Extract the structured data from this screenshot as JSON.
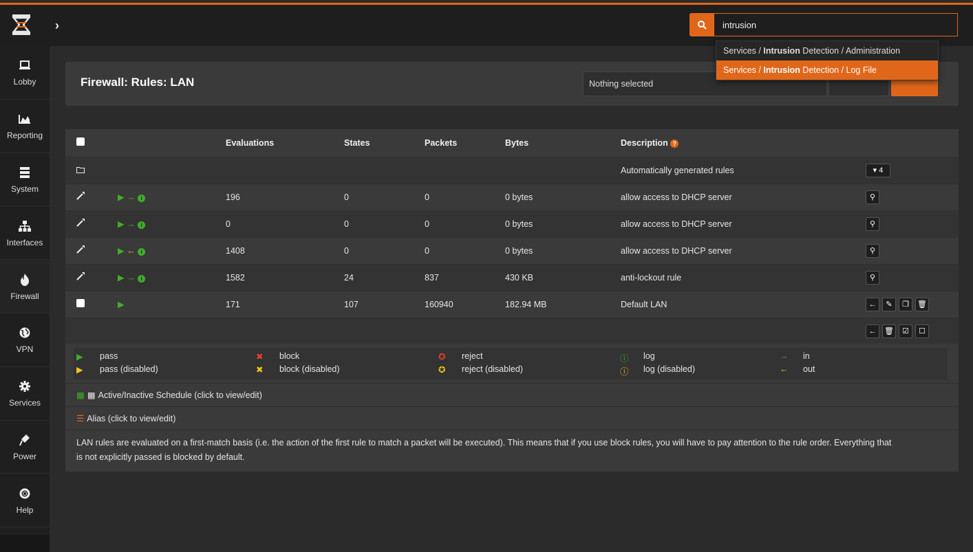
{
  "header": {
    "search_value": "intrusion",
    "dropdown": [
      {
        "pre": "Services / ",
        "bold": "Intrusion",
        "post": " Detection / Administration",
        "active": false
      },
      {
        "pre": "Services / ",
        "bold": "Intrusion",
        "post": " Detection / Log File",
        "active": true
      }
    ]
  },
  "nav": {
    "items": [
      {
        "label": "Lobby",
        "icon": "laptop-icon"
      },
      {
        "label": "Reporting",
        "icon": "area-chart-icon"
      },
      {
        "label": "System",
        "icon": "server-icon"
      },
      {
        "label": "Interfaces",
        "icon": "sitemap-icon"
      },
      {
        "label": "Firewall",
        "icon": "fire-icon"
      },
      {
        "label": "VPN",
        "icon": "globe-icon"
      },
      {
        "label": "Services",
        "icon": "cog-icon"
      },
      {
        "label": "Power",
        "icon": "plug-icon"
      },
      {
        "label": "Help",
        "icon": "life-ring-icon"
      }
    ]
  },
  "page": {
    "title": "Firewall: Rules: LAN",
    "select_value": "Nothing selected"
  },
  "table": {
    "headers": {
      "evaluations": "Evaluations",
      "states": "States",
      "packets": "Packets",
      "bytes": "Bytes",
      "description": "Description"
    },
    "auto_rules": {
      "description": "Automatically generated rules",
      "count": "4"
    },
    "rows": [
      {
        "evaluations": "196",
        "states": "0",
        "packets": "0",
        "bytes": "0 bytes",
        "description": "allow access to DHCP server",
        "direction": "in"
      },
      {
        "evaluations": "0",
        "states": "0",
        "packets": "0",
        "bytes": "0 bytes",
        "description": "allow access to DHCP server",
        "direction": "in"
      },
      {
        "evaluations": "1408",
        "states": "0",
        "packets": "0",
        "bytes": "0 bytes",
        "description": "allow access to DHCP server",
        "direction": "out"
      },
      {
        "evaluations": "1582",
        "states": "24",
        "packets": "837",
        "bytes": "430 KB",
        "description": "anti-lockout rule",
        "direction": "in"
      }
    ],
    "default_row": {
      "evaluations": "171",
      "states": "107",
      "packets": "160940",
      "bytes": "182.94 MB",
      "description": "Default LAN"
    }
  },
  "legend": {
    "pass": "pass",
    "pass_disabled": "pass (disabled)",
    "block": "block",
    "block_disabled": "block (disabled)",
    "reject": "reject",
    "reject_disabled": "reject (disabled)",
    "log": "log",
    "log_disabled": "log (disabled)",
    "in": "in",
    "out": "out"
  },
  "schedule_text": "Active/Inactive Schedule (click to view/edit)",
  "alias_text": "Alias (click to view/edit)",
  "note_line1": "LAN rules are evaluated on a first-match basis (i.e. the action of the first rule to match a packet will be executed). This means that if you use block rules, you will have to pay attention to the rule order. Everything that",
  "note_line2": "is not explicitly passed is blocked by default.",
  "colors": {
    "accent": "#e0671a",
    "pass": "#3fae29",
    "block": "#e8402f",
    "disabled": "#f0c419"
  }
}
